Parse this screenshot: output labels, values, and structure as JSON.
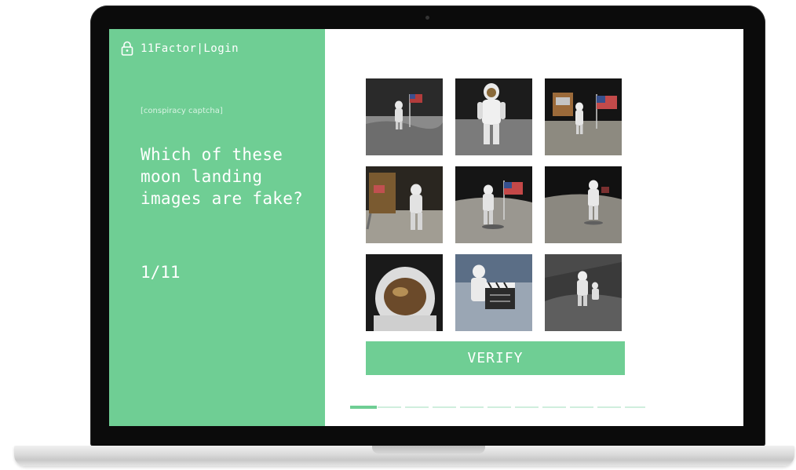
{
  "app": {
    "brand": "11Factor|Login"
  },
  "left_panel": {
    "eyebrow": "[conspiracy captcha]",
    "question": "Which of these moon landing images are fake?",
    "counter": "1/11"
  },
  "grid": {
    "images": [
      {
        "icon": "astronaut-with-flag-photo"
      },
      {
        "icon": "astronaut-standing-photo"
      },
      {
        "icon": "astronauts-with-flag-photo"
      },
      {
        "icon": "lunar-module-astronaut-photo"
      },
      {
        "icon": "astronaut-saluting-flag-photo"
      },
      {
        "icon": "astronaut-walking-photo"
      },
      {
        "icon": "astronaut-helmet-closeup-photo"
      },
      {
        "icon": "astronaut-film-clapperboard-photo"
      },
      {
        "icon": "astronaut-on-dark-surface-photo"
      }
    ]
  },
  "actions": {
    "verify_label": "VERIFY"
  },
  "progress": {
    "current": 1,
    "total": 11,
    "fraction": 0.0909
  },
  "colors": {
    "accent": "#6fce94",
    "screen_bezel": "#0b0b0b",
    "background": "#ffffff"
  }
}
